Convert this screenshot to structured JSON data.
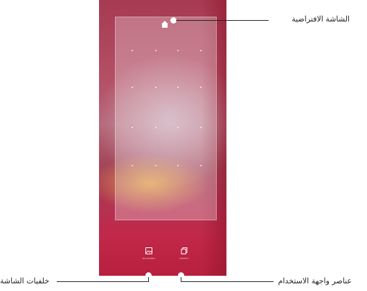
{
  "callouts": {
    "home_screen": "الشاشة الافتراضية",
    "ui_elements": "عناصر واجهة الاستخدام",
    "wallpapers": "خلفيات الشاشة"
  },
  "bottom_options": {
    "wallpapers_label": "WALLPAPERS",
    "widgets_label": "WIDGETS"
  },
  "icons": {
    "home": "house-icon",
    "wallpaper": "image-icon",
    "widgets": "widgets-icon"
  },
  "colors": {
    "screen_base": "#b03552",
    "callout_line": "#222222"
  }
}
